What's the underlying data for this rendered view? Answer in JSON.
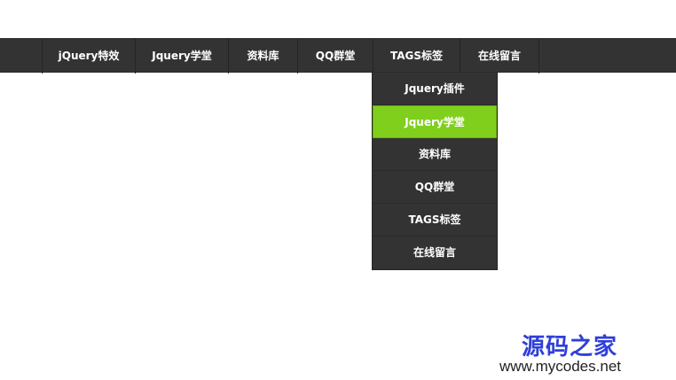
{
  "nav": {
    "items": [
      {
        "label": "jQuery特效"
      },
      {
        "label": "Jquery学堂"
      },
      {
        "label": "资料库"
      },
      {
        "label": "QQ群堂"
      },
      {
        "label": "TAGS标签"
      },
      {
        "label": "在线留言"
      }
    ]
  },
  "dropdown": {
    "items": [
      {
        "label": "Jquery插件"
      },
      {
        "label": "Jquery学堂",
        "active": true
      },
      {
        "label": "资料库"
      },
      {
        "label": "QQ群堂"
      },
      {
        "label": "TAGS标签"
      },
      {
        "label": "在线留言"
      }
    ]
  },
  "watermark": {
    "name": "源码之家",
    "url": "www.mycodes.net"
  },
  "colors": {
    "nav_bg": "#333333",
    "active_bg": "#7fcf1c",
    "text": "#ffffff",
    "watermark_name": "#2f3fd8"
  }
}
